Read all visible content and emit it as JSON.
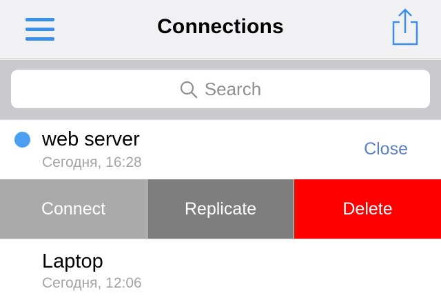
{
  "navbar": {
    "title": "Connections",
    "menu_icon": "hamburger-menu-icon",
    "share_icon": "share-icon",
    "accent_color": "#3a8fe8"
  },
  "search": {
    "placeholder": "Search",
    "icon": "search-icon"
  },
  "connections": [
    {
      "name": "web server",
      "time": "Сегодня, 16:28",
      "status_color": "#4a9ff3",
      "close_label": "Close",
      "actions": [
        {
          "label": "Connect",
          "color": "#aaaaaa"
        },
        {
          "label": "Replicate",
          "color": "#7e7e7e"
        },
        {
          "label": "Delete",
          "color": "#ff0000"
        }
      ]
    },
    {
      "name": "Laptop",
      "time": "Сегодня, 12:06"
    }
  ]
}
